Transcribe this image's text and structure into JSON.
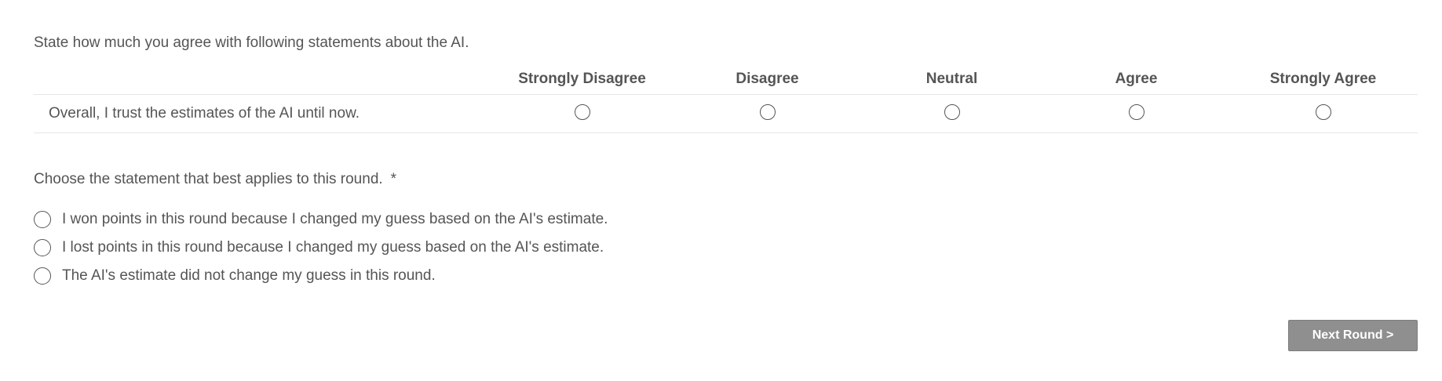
{
  "matrix": {
    "question": "State how much you agree with following statements about the AI.",
    "columns": [
      "Strongly Disagree",
      "Disagree",
      "Neutral",
      "Agree",
      "Strongly Agree"
    ],
    "rows": [
      {
        "label": "Overall, I trust the estimates of the AI until now."
      }
    ]
  },
  "choice": {
    "question": "Choose the statement that best applies to this round.",
    "required_mark": "*",
    "options": [
      "I won points in this round because I changed my guess based on the AI's estimate.",
      "I lost points in this round because I changed my guess based on the AI's estimate.",
      "The AI's estimate did not change my guess in this round."
    ]
  },
  "footer": {
    "next_label": "Next Round >"
  }
}
